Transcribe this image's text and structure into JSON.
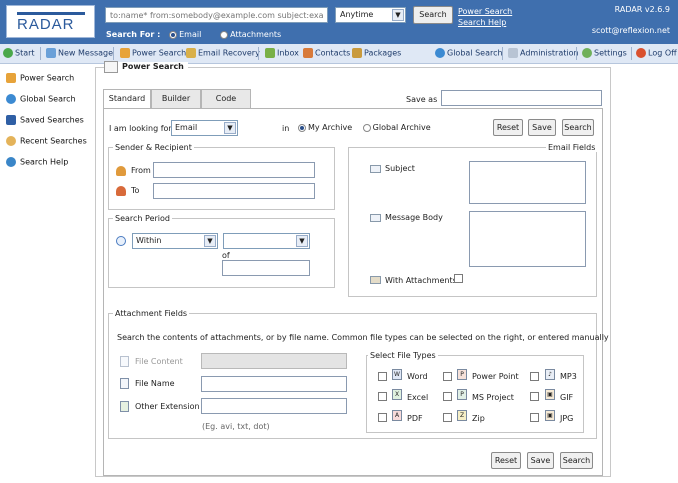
{
  "header": {
    "logo_text": "RADAR",
    "search_placeholder": "to:name* from:somebody@example.com subject:example",
    "period": "Anytime",
    "search_button": "Search",
    "links": [
      "Power Search",
      "Search Help"
    ],
    "version": "RADAR v2.6.9",
    "user": "scott@reflexion.net",
    "search_for_label": "Search For :",
    "search_for_options": [
      "Email",
      "Attachments"
    ],
    "search_for_selected": "Email"
  },
  "toolbar": {
    "items": [
      "Start",
      "New Message",
      "Power Search",
      "Email Recovery",
      "Inbox",
      "Contacts",
      "Packages",
      "Global Search",
      "Administration",
      "Settings",
      "Log Off"
    ]
  },
  "sidebar": {
    "items": [
      "Power Search",
      "Global Search",
      "Saved Searches",
      "Recent Searches",
      "Search Help"
    ]
  },
  "main": {
    "title": "Power Search",
    "tabs": [
      "Standard",
      "Builder",
      "Code"
    ],
    "active_tab": "Standard",
    "save_as_label": "Save as",
    "looking_for_label": "I am looking for:",
    "looking_for_value": "Email",
    "in_label": "in",
    "archive_options": [
      "My Archive",
      "Global Archive"
    ],
    "archive_selected": "My Archive",
    "buttons": {
      "reset": "Reset",
      "save": "Save",
      "search": "Search"
    },
    "sender_recipient": {
      "legend": "Sender & Recipient",
      "from_label": "From",
      "to_label": "To"
    },
    "search_period": {
      "legend": "Search Period",
      "mode": "Within",
      "of_label": "of"
    },
    "email_fields": {
      "legend": "Email Fields",
      "subject_label": "Subject",
      "body_label": "Message Body",
      "attachments_label": "With Attachments"
    },
    "attachment_fields": {
      "legend": "Attachment Fields",
      "description": "Search the contents of attachments, or by file name. Common file types can be selected on the right, or entered manually",
      "file_content_label": "File Content",
      "file_name_label": "File Name",
      "other_ext_label": "Other Extension",
      "ext_hint": "(Eg. avi, txt, dot)",
      "file_types_legend": "Select File Types",
      "file_types": [
        [
          "Word",
          "Power Point",
          "MP3"
        ],
        [
          "Excel",
          "MS Project",
          "GIF"
        ],
        [
          "PDF",
          "Zip",
          "JPG"
        ]
      ]
    }
  }
}
